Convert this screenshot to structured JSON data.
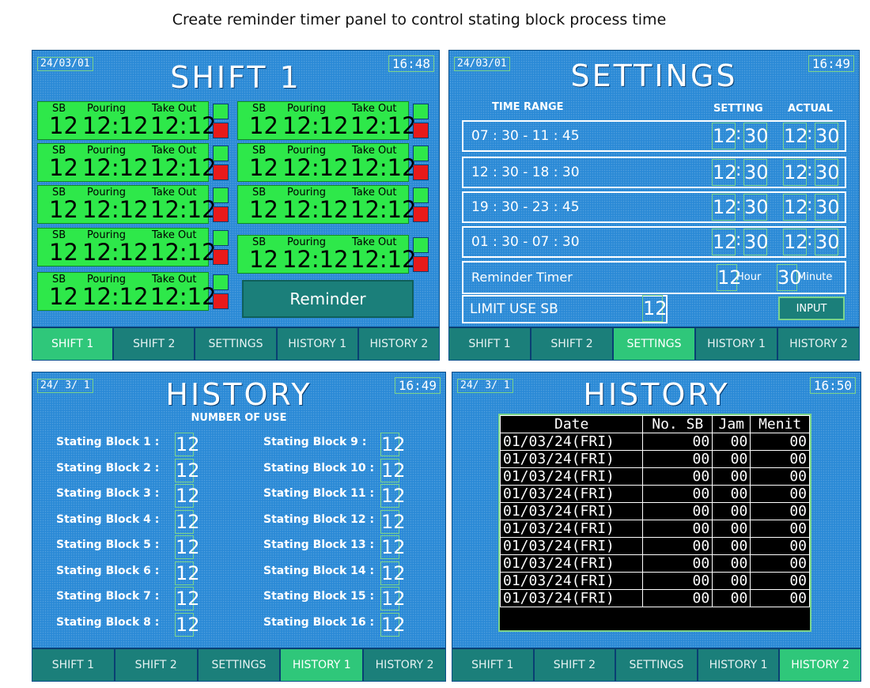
{
  "header": {
    "title": "Create reminder timer panel to control stating block process time"
  },
  "tabs": [
    "SHIFT 1",
    "SHIFT 2",
    "SETTINGS",
    "HISTORY 1",
    "HISTORY 2"
  ],
  "colors": {
    "panel_bg": "#2b8ad6",
    "tab_bg": "#1b7f7a",
    "tab_active": "#2fc77a",
    "block_green": "#2ee84a",
    "indicator_red": "#e81a1a"
  },
  "shift": {
    "date": "24/03/01",
    "time": "16:48",
    "title": "SHIFT 1",
    "col_sb": "SB",
    "col_pouring": "Pouring",
    "col_takeout": "Take Out",
    "sb_value": "12",
    "pouring_value": "12:12",
    "takeout_value": "12:12",
    "reminder_label": "Reminder",
    "active_tab": "SHIFT 1"
  },
  "settings": {
    "date": "24/03/01",
    "time": "16:49",
    "title": "SETTINGS",
    "col_range": "TIME RANGE",
    "col_setting": "SETTING",
    "col_actual": "ACTUAL",
    "rows": [
      {
        "range": "07 : 30 - 11 : 45",
        "set_h": "12",
        "set_m": "30",
        "act_h": "12",
        "act_m": "30"
      },
      {
        "range": "12 : 30 - 18 : 30",
        "set_h": "12",
        "set_m": "30",
        "act_h": "12",
        "act_m": "30"
      },
      {
        "range": "19 : 30 - 23 : 45",
        "set_h": "12",
        "set_m": "30",
        "act_h": "12",
        "act_m": "30"
      },
      {
        "range": "01 : 30 - 07 : 30",
        "set_h": "12",
        "set_m": "30",
        "act_h": "12",
        "act_m": "30"
      }
    ],
    "reminder_label": "Reminder Timer",
    "reminder_hour": "12",
    "hour_label": "Hour",
    "reminder_minute": "30",
    "minute_label": "Minute",
    "limit_label": "LIMIT USE SB",
    "limit_value": "12",
    "input_label": "INPUT",
    "colon": ":"
  },
  "history1": {
    "date": "24/ 3/ 1",
    "time": "16:49",
    "title": "HISTORY",
    "subtitle": "NUMBER OF USE",
    "items": [
      {
        "label": "Stating Block 1 :",
        "value": "12"
      },
      {
        "label": "Stating Block 2 :",
        "value": "12"
      },
      {
        "label": "Stating Block 3 :",
        "value": "12"
      },
      {
        "label": "Stating Block 4 :",
        "value": "12"
      },
      {
        "label": "Stating Block 5 :",
        "value": "12"
      },
      {
        "label": "Stating Block 6 :",
        "value": "12"
      },
      {
        "label": "Stating Block 7 :",
        "value": "12"
      },
      {
        "label": "Stating Block 8 :",
        "value": "12"
      },
      {
        "label": "Stating Block 9 :",
        "value": "12"
      },
      {
        "label": "Stating Block 10 :",
        "value": "12"
      },
      {
        "label": "Stating Block 11 :",
        "value": "12"
      },
      {
        "label": "Stating Block 12 :",
        "value": "12"
      },
      {
        "label": "Stating Block 13 :",
        "value": "12"
      },
      {
        "label": "Stating Block 14 :",
        "value": "12"
      },
      {
        "label": "Stating Block 15 :",
        "value": "12"
      },
      {
        "label": "Stating Block 16 :",
        "value": "12"
      }
    ]
  },
  "history2": {
    "date": "24/ 3/ 1",
    "time": "16:50",
    "title": "HISTORY",
    "columns": [
      "Date",
      "No. SB",
      "Jam",
      "Menit"
    ],
    "rows": [
      [
        "01/03/24(FRI)",
        "00",
        "00",
        "00"
      ],
      [
        "01/03/24(FRI)",
        "00",
        "00",
        "00"
      ],
      [
        "01/03/24(FRI)",
        "00",
        "00",
        "00"
      ],
      [
        "01/03/24(FRI)",
        "00",
        "00",
        "00"
      ],
      [
        "01/03/24(FRI)",
        "00",
        "00",
        "00"
      ],
      [
        "01/03/24(FRI)",
        "00",
        "00",
        "00"
      ],
      [
        "01/03/24(FRI)",
        "00",
        "00",
        "00"
      ],
      [
        "01/03/24(FRI)",
        "00",
        "00",
        "00"
      ],
      [
        "01/03/24(FRI)",
        "00",
        "00",
        "00"
      ],
      [
        "01/03/24(FRI)",
        "00",
        "00",
        "00"
      ]
    ]
  }
}
